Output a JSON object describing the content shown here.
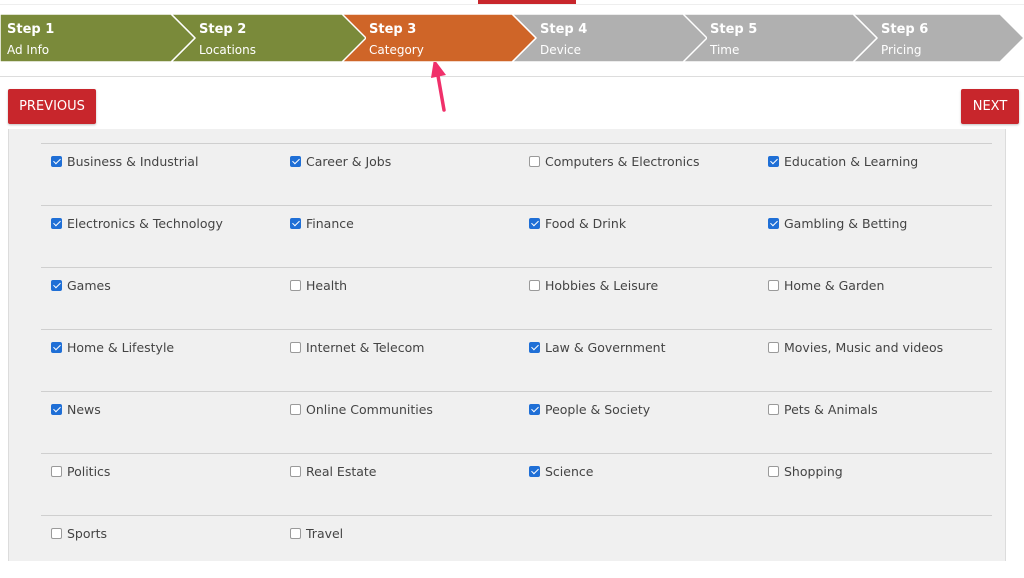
{
  "steps": [
    {
      "num": "Step 1",
      "sub": "Ad Info",
      "color": "#7a8a3a",
      "state": "done"
    },
    {
      "num": "Step 2",
      "sub": "Locations",
      "color": "#7a8a3a",
      "state": "done"
    },
    {
      "num": "Step 3",
      "sub": "Category",
      "color": "#cf6528",
      "state": "current"
    },
    {
      "num": "Step 4",
      "sub": "Device",
      "color": "#b0b0b0",
      "state": "todo"
    },
    {
      "num": "Step 5",
      "sub": "Time",
      "color": "#b0b0b0",
      "state": "todo"
    },
    {
      "num": "Step 6",
      "sub": "Pricing",
      "color": "#b0b0b0",
      "state": "todo"
    }
  ],
  "nav": {
    "previous_label": "PREVIOUS",
    "next_label": "NEXT"
  },
  "colors": {
    "accent": "#c8262c",
    "checkbox_checked": "#1f6fd6",
    "annotation_arrow": "#f0306a"
  },
  "categories": [
    [
      {
        "label": "Business & Industrial",
        "checked": true
      },
      {
        "label": "Career & Jobs",
        "checked": true
      },
      {
        "label": "Computers & Electronics",
        "checked": false
      },
      {
        "label": "Education & Learning",
        "checked": true
      }
    ],
    [
      {
        "label": "Electronics & Technology",
        "checked": true
      },
      {
        "label": "Finance",
        "checked": true
      },
      {
        "label": "Food & Drink",
        "checked": true
      },
      {
        "label": "Gambling & Betting",
        "checked": true
      }
    ],
    [
      {
        "label": "Games",
        "checked": true
      },
      {
        "label": "Health",
        "checked": false
      },
      {
        "label": "Hobbies & Leisure",
        "checked": false
      },
      {
        "label": "Home & Garden",
        "checked": false
      }
    ],
    [
      {
        "label": "Home & Lifestyle",
        "checked": true
      },
      {
        "label": "Internet & Telecom",
        "checked": false
      },
      {
        "label": "Law & Government",
        "checked": true
      },
      {
        "label": "Movies, Music and videos",
        "checked": false
      }
    ],
    [
      {
        "label": "News",
        "checked": true
      },
      {
        "label": "Online Communities",
        "checked": false
      },
      {
        "label": "People & Society",
        "checked": true
      },
      {
        "label": "Pets & Animals",
        "checked": false
      }
    ],
    [
      {
        "label": "Politics",
        "checked": false
      },
      {
        "label": "Real Estate",
        "checked": false
      },
      {
        "label": "Science",
        "checked": true
      },
      {
        "label": "Shopping",
        "checked": false
      }
    ],
    [
      {
        "label": "Sports",
        "checked": false
      },
      {
        "label": "Travel",
        "checked": false
      }
    ]
  ]
}
